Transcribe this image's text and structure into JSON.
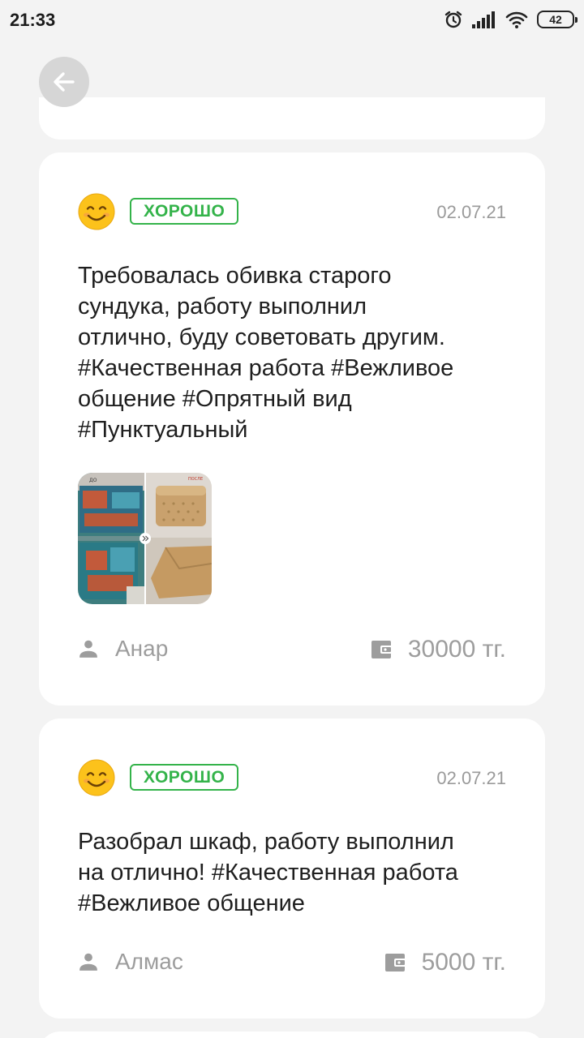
{
  "status_bar": {
    "time": "21:33",
    "battery_level": "42"
  },
  "reviews": [
    {
      "rating_label": "ХОРОШО",
      "date": "02.07.21",
      "text_lines": [
        "Требовалась обивка старого",
        "сундука, работу выполнил",
        "отлично, буду советовать другим.",
        "#Качественная работа #Вежливое",
        "общение #Опрятный вид",
        "#Пунктуальный"
      ],
      "photo_labels": {
        "before": "ДО",
        "after": "ПОСЛЕ"
      },
      "author": "Анар",
      "price": "30000 тг."
    },
    {
      "rating_label": "ХОРОШО",
      "date": "02.07.21",
      "text_lines": [
        "Разобрал шкаф, работу выполнил",
        "на отлично! #Качественная работа",
        "#Вежливое общение"
      ],
      "author": "Алмас",
      "price": "5000 тг."
    }
  ],
  "colors": {
    "background": "#f3f3f3",
    "card": "#ffffff",
    "badge_green": "#34b34a",
    "muted_text": "#9d9d9d"
  }
}
